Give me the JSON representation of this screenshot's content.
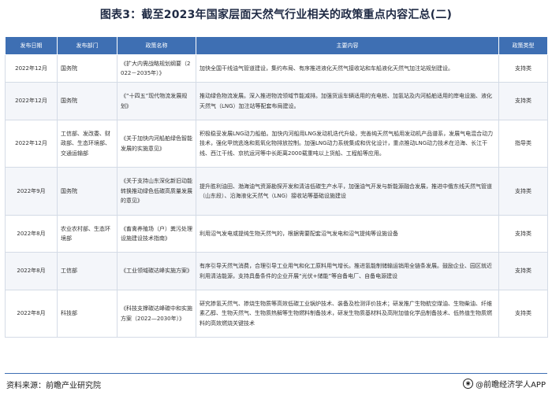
{
  "title": "图表3：截至2023年国家层面天然气行业相关的政策重点内容汇总(二)",
  "table": {
    "headers": [
      "发布日期",
      "发布部门",
      "政策名称",
      "主要内容",
      "政策类型"
    ],
    "rows": [
      {
        "date": "2022年12月",
        "dept": "国务院",
        "policy": "《扩大内需战略规划纲要（2022－2035年）》",
        "content": "加快全国干线油气管道建设，集约布局、有序推进液化天然气接收站和车船液化天然气加注站规划建设。",
        "type": "支持类"
      },
      {
        "date": "2022年12月",
        "dept": "国务院",
        "policy": "《“十四五”现代物流发展规划》",
        "content": "推动绿色物流发展。深入推进物流领域节能减排。加强货运车辆适用的充电桩、加氢站及内河船舶适用的岸电设施、液化天然气（LNG）加注站等配套布局建设。",
        "type": "支持类"
      },
      {
        "date": "2022年12月",
        "dept": "工信部、发改委、财政部、生态环境部、交通运输部",
        "policy": "《关于加快内河船舶绿色智能发展的实施意见》",
        "content": "积极稳妥发展LNG动力船舶。加快内河船用LNG发动机迭代升级，完善纯天然气船用发动机产品谱系，发展气电混合动力技术，强化甲烷逃逸和氮氧化物排放控制。加强LNG动力系统集成和优化设计，重点推动LNG动力技术在沿海、长江干线、西江干线、京杭运河等中长距离2000载重吨以上货船、工程船等应用。",
        "type": "指导类"
      },
      {
        "date": "2022年9月",
        "dept": "国务院",
        "policy": "《关于支持山东深化新旧动能转换推动绿色低碳高质量发展的意见》",
        "content": "提升胜利油田、渤海油气资源勘探开发和清洁低碳生产水平，加强油气开发与新能源融合发展，推进中俄东线天然气管道（山东段）、沿海液化天然气（LNG）接收站等基础设施建设",
        "type": "支持类"
      },
      {
        "date": "2022年8月",
        "dept": "农业农村部、生态环境部",
        "policy": "《畜禽养殖场（户）粪污处理设施建设技术指南》",
        "content": "利用沼气发电或提纯生物天然气的，根据需要配套沼气发电和沼气提纯等设施设备",
        "type": "支持类"
      },
      {
        "date": "2022年8月",
        "dept": "工信部",
        "policy": "《工业领域碳达峰实施方案》",
        "content": "有序引导天然气消费，合理引导工业用气和化工原料用气增长。推进氢能制储输运销用全链条发展。鼓励企业、园区就近利用清洁能源，支持具备条件的企业开展“光伏+储能”等自备电厂、自备电源建设",
        "type": "支持类"
      },
      {
        "date": "2022年8月",
        "dept": "科技部",
        "policy": "《科技支撑碳达峰碳中和实施方案（2022—2030年）》",
        "content": "研究掺氢天然气、掺烧生物质等高效低碳工业锅炉技术、装备及检测评价技术；研发推广生物航空煤油、生物柴油、纤维素乙醇、生物天然气、生物质热解等生物燃料制备技术，研发生物质基材料及高附加值化学品制备技术、低热值生物质燃料的高效燃烧关键技术",
        "type": "支持类"
      }
    ]
  },
  "footer": {
    "source": "资料来源：前瞻产业研究院",
    "brand_icon": "eye-logo-icon",
    "brand": "@前瞻经济学人APP"
  },
  "watermark": "前瞻产业研究院"
}
